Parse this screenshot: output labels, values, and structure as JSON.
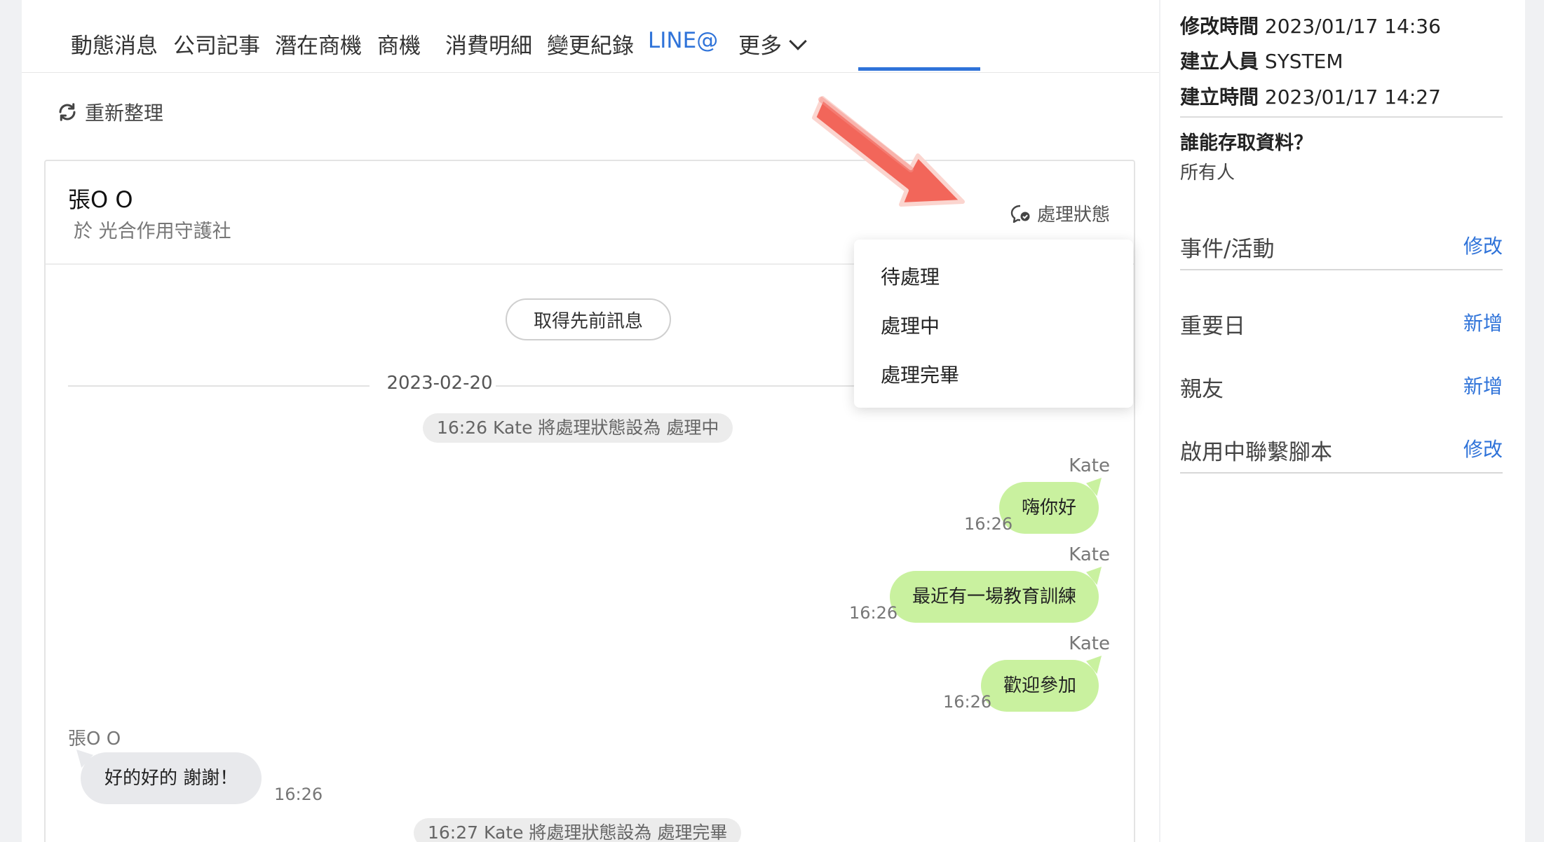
{
  "tabs": [
    {
      "label": "動態消息"
    },
    {
      "label": "公司記事"
    },
    {
      "label": "潛在商機"
    },
    {
      "label": "商機"
    },
    {
      "label": "消費明細"
    },
    {
      "label": "變更紀錄"
    },
    {
      "label": "LINE@"
    },
    {
      "label": "更多"
    }
  ],
  "active_tab": "LINE@",
  "refresh_label": "重新整理",
  "chat": {
    "contact_name": "張O O",
    "contact_org": "於 光合作用守護社",
    "status_label": "處理狀態",
    "prev_button": "取得先前訊息",
    "date": "2023-02-20",
    "system_1": "16:26  Kate 將處理狀態設為 處理中",
    "messages": [
      {
        "sender": "Kate",
        "text": "嗨你好",
        "time": "16:26"
      },
      {
        "sender": "Kate",
        "text": "最近有一場教育訓練",
        "time": "16:26"
      },
      {
        "sender": "Kate",
        "text": "歡迎參加",
        "time": "16:26"
      }
    ],
    "incoming": {
      "sender": "張O O",
      "text": "好的好的 謝謝！",
      "time": "16:26"
    },
    "system_2": "16:27  Kate 將處理狀態設為 處理完畢"
  },
  "status_dropdown": {
    "options": [
      "待處理",
      "處理中",
      "處理完畢"
    ]
  },
  "side": {
    "modified_label": "修改時間",
    "modified_value": "2023/01/17 14:36",
    "creator_label": "建立人員",
    "creator_value": "SYSTEM",
    "created_label": "建立時間",
    "created_value": "2023/01/17 14:27",
    "access_heading": "誰能存取資料？",
    "access_value": "所有人",
    "sections": [
      {
        "title": "事件/活動",
        "action": "修改"
      },
      {
        "title": "重要日",
        "action": "新增"
      },
      {
        "title": "親友",
        "action": "新增"
      },
      {
        "title": "啟用中聯繫腳本",
        "action": "修改"
      }
    ]
  },
  "colors": {
    "accent": "#2f73d9",
    "bubble_out": "#c9f19f",
    "bubble_in": "#e8e9ec",
    "arrow": "#f2665a"
  }
}
